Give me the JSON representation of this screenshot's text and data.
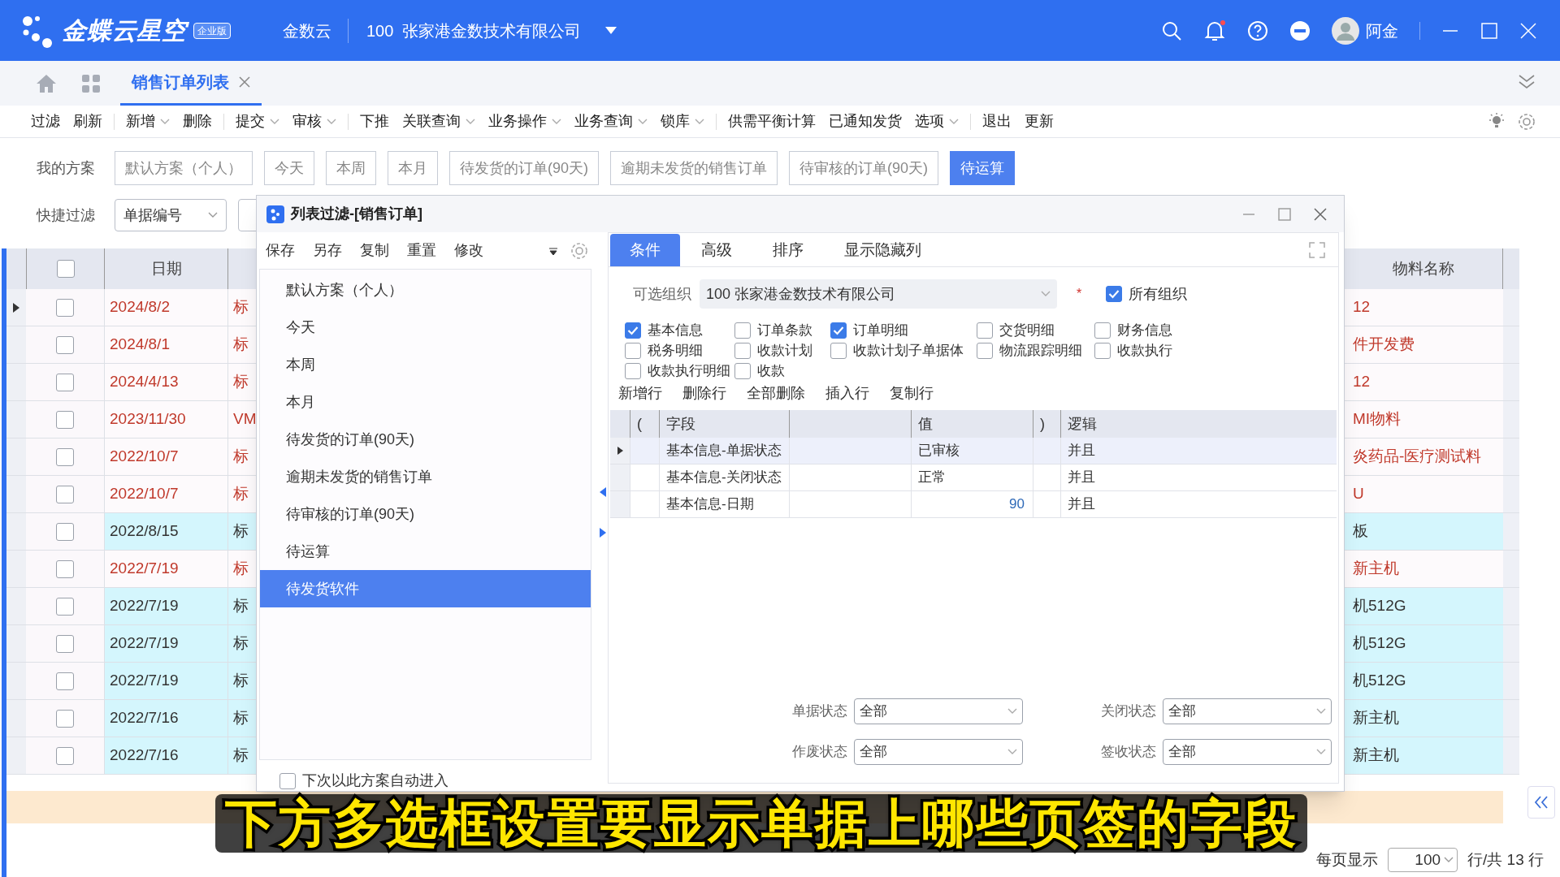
{
  "header": {
    "logo_text": "金蝶云星空",
    "edition": "企业版",
    "app": "金数云",
    "org": "100  张家港金数技术有限公司",
    "user": "阿金"
  },
  "tabs": [
    {
      "label": "销售订单列表",
      "selected": true
    }
  ],
  "toolbar": [
    {
      "label": "过滤",
      "dropdown": false
    },
    {
      "label": "刷新",
      "dropdown": false
    },
    {
      "label": "新增",
      "dropdown": true
    },
    {
      "label": "删除",
      "dropdown": false
    },
    {
      "label": "提交",
      "dropdown": true
    },
    {
      "label": "审核",
      "dropdown": true
    },
    {
      "label": "下推",
      "dropdown": false
    },
    {
      "label": "关联查询",
      "dropdown": true
    },
    {
      "label": "业务操作",
      "dropdown": true
    },
    {
      "label": "业务查询",
      "dropdown": true
    },
    {
      "label": "锁库",
      "dropdown": true
    },
    {
      "label": "供需平衡计算",
      "dropdown": false
    },
    {
      "label": "已通知发货",
      "dropdown": false
    },
    {
      "label": "选项",
      "dropdown": true
    },
    {
      "label": "退出",
      "dropdown": false
    },
    {
      "label": "更新",
      "dropdown": false
    }
  ],
  "schemes": {
    "label": "我的方案",
    "items": [
      {
        "label": "默认方案（个人）",
        "selected": false
      },
      {
        "label": "今天",
        "selected": false
      },
      {
        "label": "本周",
        "selected": false
      },
      {
        "label": "本月",
        "selected": false
      },
      {
        "label": "待发货的订单(90天)",
        "selected": false
      },
      {
        "label": "逾期未发货的销售订单",
        "selected": false
      },
      {
        "label": "待审核的订单(90天)",
        "selected": false
      },
      {
        "label": "待运算",
        "selected": true
      }
    ]
  },
  "quick_filter": {
    "label": "快捷过滤",
    "field": "单据编号"
  },
  "table": {
    "all_checked": false,
    "columns": [
      "日期",
      "物料名称"
    ],
    "rows": [
      {
        "date": "2024/8/2",
        "column_3": "标",
        "material": "12",
        "highlighted": false,
        "current": true,
        "checked": false
      },
      {
        "date": "2024/8/1",
        "column_3": "标",
        "material": "件开发费",
        "highlighted": false,
        "current": false,
        "checked": false
      },
      {
        "date": "2024/4/13",
        "column_3": "标",
        "material": "12",
        "highlighted": false,
        "current": false,
        "checked": false
      },
      {
        "date": "2023/11/30",
        "column_3": "VM",
        "material": "MI物料",
        "highlighted": false,
        "current": false,
        "checked": false
      },
      {
        "date": "2022/10/7",
        "column_3": "标",
        "material": "炎药品-医疗测试料",
        "highlighted": false,
        "current": false,
        "checked": false
      },
      {
        "date": "2022/10/7",
        "column_3": "标",
        "material": "U",
        "highlighted": false,
        "current": false,
        "checked": false
      },
      {
        "date": "2022/8/15",
        "column_3": "标",
        "material": "板",
        "highlighted": true,
        "current": false,
        "checked": false
      },
      {
        "date": "2022/7/19",
        "column_3": "标",
        "material": "新主机",
        "highlighted": false,
        "current": false,
        "checked": false
      },
      {
        "date": "2022/7/19",
        "column_3": "标",
        "material": "机512G",
        "highlighted": true,
        "current": false,
        "checked": false
      },
      {
        "date": "2022/7/19",
        "column_3": "标",
        "material": "机512G",
        "highlighted": true,
        "current": false,
        "checked": false
      },
      {
        "date": "2022/7/19",
        "column_3": "标",
        "material": "机512G",
        "highlighted": true,
        "current": false,
        "checked": false
      },
      {
        "date": "2022/7/16",
        "column_3": "标",
        "material": "新主机",
        "highlighted": true,
        "current": false,
        "checked": false
      },
      {
        "date": "2022/7/16",
        "column_3": "标",
        "material": "新主机",
        "highlighted": true,
        "current": false,
        "checked": false
      }
    ]
  },
  "dialog": {
    "title": "列表过滤-[销售订单]",
    "scheme_actions": [
      "保存",
      "另存",
      "复制",
      "重置",
      "修改"
    ],
    "schemes": [
      {
        "label": "默认方案（个人）",
        "selected": false
      },
      {
        "label": "今天",
        "selected": false
      },
      {
        "label": "本周",
        "selected": false
      },
      {
        "label": "本月",
        "selected": false
      },
      {
        "label": "待发货的订单(90天)",
        "selected": false
      },
      {
        "label": "逾期未发货的销售订单",
        "selected": false
      },
      {
        "label": "待审核的订单(90天)",
        "selected": false
      },
      {
        "label": "待运算",
        "selected": false
      },
      {
        "label": "待发货软件",
        "selected": true
      }
    ],
    "auto_enter": {
      "label": "下次以此方案自动进入",
      "checked": false
    },
    "tabs": [
      {
        "label": "条件",
        "selected": true
      },
      {
        "label": "高级",
        "selected": false
      },
      {
        "label": "排序",
        "selected": false
      },
      {
        "label": "显示隐藏列",
        "selected": false
      }
    ],
    "org": {
      "label": "可选组织",
      "value": "100 张家港金数技术有限公司",
      "required": "*"
    },
    "all_orgs": {
      "label": "所有组织",
      "checked": true
    },
    "entities": [
      {
        "label": "基本信息",
        "checked": true
      },
      {
        "label": "订单条款",
        "checked": false
      },
      {
        "label": "订单明细",
        "checked": true
      },
      {
        "label": "交货明细",
        "checked": false
      },
      {
        "label": "财务信息",
        "checked": false
      },
      {
        "label": "税务明细",
        "checked": false
      },
      {
        "label": "收款计划",
        "checked": false
      },
      {
        "label": "收款计划子单据体",
        "checked": false
      },
      {
        "label": "物流跟踪明细",
        "checked": false
      },
      {
        "label": "收款执行",
        "checked": false
      },
      {
        "label": "收款执行明细",
        "checked": false
      },
      {
        "label": "收款",
        "checked": false
      }
    ],
    "row_actions": [
      "新增行",
      "删除行",
      "全部删除",
      "插入行",
      "复制行"
    ],
    "grid": {
      "columns": [
        "(",
        "字段",
        "值",
        ")",
        "逻辑"
      ],
      "rows": [
        {
          "field": "基本信息-单据状态",
          "value": "已审核",
          "logic": "并且",
          "current": true
        },
        {
          "field": "基本信息-关闭状态",
          "value": "正常",
          "logic": "并且",
          "current": false
        },
        {
          "field": "基本信息-日期",
          "value": "90",
          "logic": "并且",
          "current": false
        }
      ]
    },
    "status_fields": [
      {
        "label": "单据状态",
        "value": "全部"
      },
      {
        "label": "关闭状态",
        "value": "全部"
      },
      {
        "label": "作废状态",
        "value": "全部"
      },
      {
        "label": "签收状态",
        "value": "全部"
      }
    ]
  },
  "pager": {
    "label": "每页显示",
    "value": "100",
    "total": "行/共 13 行"
  },
  "caption": "下方多选框设置要显示单据上哪些页签的字段"
}
